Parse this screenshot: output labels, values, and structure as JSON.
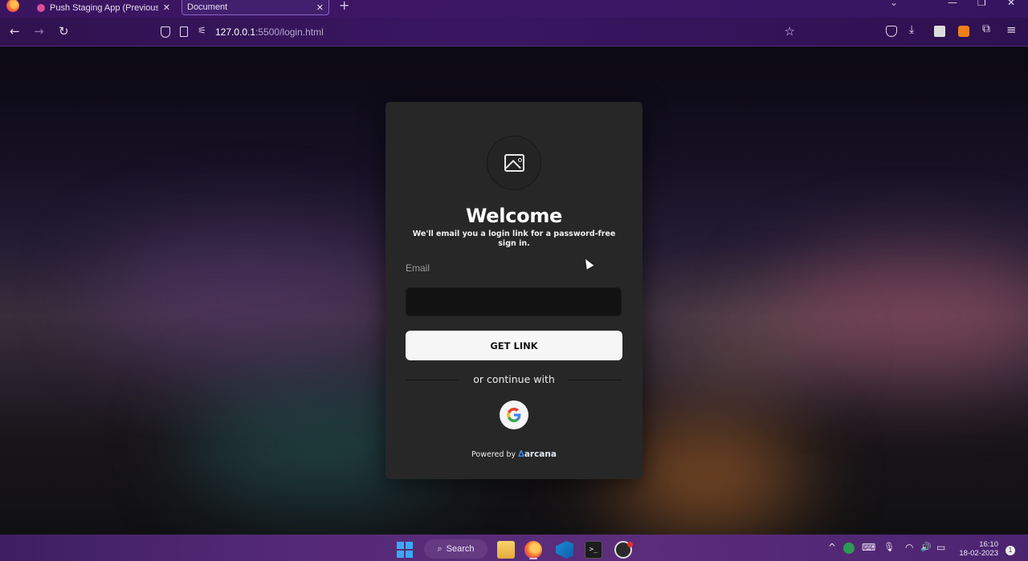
{
  "browser": {
    "tabs": [
      {
        "title": "Push Staging App (Previously EP",
        "close": "✕"
      },
      {
        "title": "Document",
        "close": "✕"
      }
    ],
    "new_tab": "+",
    "tab_list": "⌄",
    "window_controls": {
      "minimize": "—",
      "restore": "❐",
      "close": "✕"
    },
    "nav": {
      "back": "←",
      "forward": "→",
      "reload": "↻",
      "bookmark": "☆",
      "downloads": "⤓",
      "extensions": "⧉",
      "menu": "≡"
    },
    "url": {
      "host": "127.0.0.1",
      "path": ":5500/login.html"
    }
  },
  "login": {
    "title": "Welcome",
    "subtitle": "We'll email you a login link for a password-free sign in.",
    "email_label": "Email",
    "email_value": "",
    "button": "GET LINK",
    "divider": "or continue with",
    "google_letter": "G",
    "powered_by": "Powered by",
    "brand": "arcana",
    "brand_mark": "∆"
  },
  "taskbar": {
    "search": "Search",
    "search_icon": "⌕",
    "terminal_glyph": ">_",
    "tray": {
      "chevron": "^",
      "keyboard": "⌨",
      "mic": "🎙",
      "wifi": "◠",
      "volume": "🔊",
      "battery": "▭"
    },
    "time": "16:10",
    "date": "18-02-2023",
    "notification_count": "1"
  },
  "colors": {
    "card_bg": "#272727",
    "button_bg": "#f7f7f7",
    "brand_blue": "#3b8df5",
    "taskbar": "#552a77"
  }
}
